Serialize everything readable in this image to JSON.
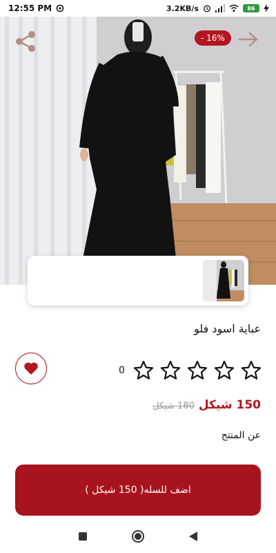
{
  "status_bar": {
    "time": "12:55 PM",
    "network_speed": "3.2KB/s",
    "battery": "86"
  },
  "product": {
    "discount_badge": "- 16%",
    "title": "عباية اسود فلو",
    "rating_count": "0",
    "rating_stars": 0,
    "rating_max": 5,
    "price_current": "150 شيكل",
    "price_old": "180 شيكل",
    "about_label": "عن المنتج"
  },
  "cart": {
    "add_label": "اضف للسله( 150 شيكل )"
  },
  "icons": {
    "share": "share-icon",
    "forward": "arrow-right-icon",
    "favorite": "heart-icon",
    "star": "star-outline-icon",
    "nav_recents": "square-icon",
    "nav_home": "circle-icon",
    "nav_back": "triangle-back-icon"
  },
  "colors": {
    "accent": "#b3161f",
    "button": "#a8141d",
    "old_price": "#9a9a9a"
  }
}
